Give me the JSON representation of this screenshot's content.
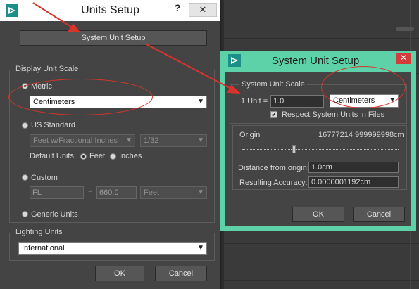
{
  "units_setup": {
    "title": "Units Setup",
    "help": "?",
    "close": "✕",
    "system_unit_setup_button": "System Unit Setup",
    "display_unit_scale": {
      "label": "Display Unit Scale",
      "metric_label": "Metric",
      "metric_value": "Centimeters",
      "us_standard_label": "US Standard",
      "us_value": "Feet w/Fractional Inches",
      "us_fraction": "1/32",
      "default_units_label": "Default Units:",
      "feet_label": "Feet",
      "inches_label": "Inches",
      "custom_label": "Custom",
      "custom_name": "FL",
      "custom_equals": "=",
      "custom_value": "660.0",
      "custom_unit": "Feet",
      "generic_label": "Generic Units",
      "selected": "Metric"
    },
    "lighting_units": {
      "label": "Lighting Units",
      "value": "International"
    },
    "ok": "OK",
    "cancel": "Cancel"
  },
  "system_unit_setup": {
    "title": "System Unit Setup",
    "close": "✕",
    "scale_group_label": "System Unit Scale",
    "one_unit_label": "1 Unit =",
    "one_unit_value": "1.0",
    "unit_value": "Centimeters",
    "respect_label": "Respect System Units in Files",
    "respect_checked": true,
    "origin_label": "Origin",
    "origin_value": "16777214.999999998cm",
    "distance_label": "Distance from origin:",
    "distance_value": "1.0cm",
    "accuracy_label": "Resulting Accuracy:",
    "accuracy_value": "0.0000001192cm",
    "ok": "OK",
    "cancel": "Cancel"
  },
  "colors": {
    "dialog_bg": "#444444",
    "accent_title": "#5dd1a8",
    "annotation_red": "#d9342b"
  }
}
